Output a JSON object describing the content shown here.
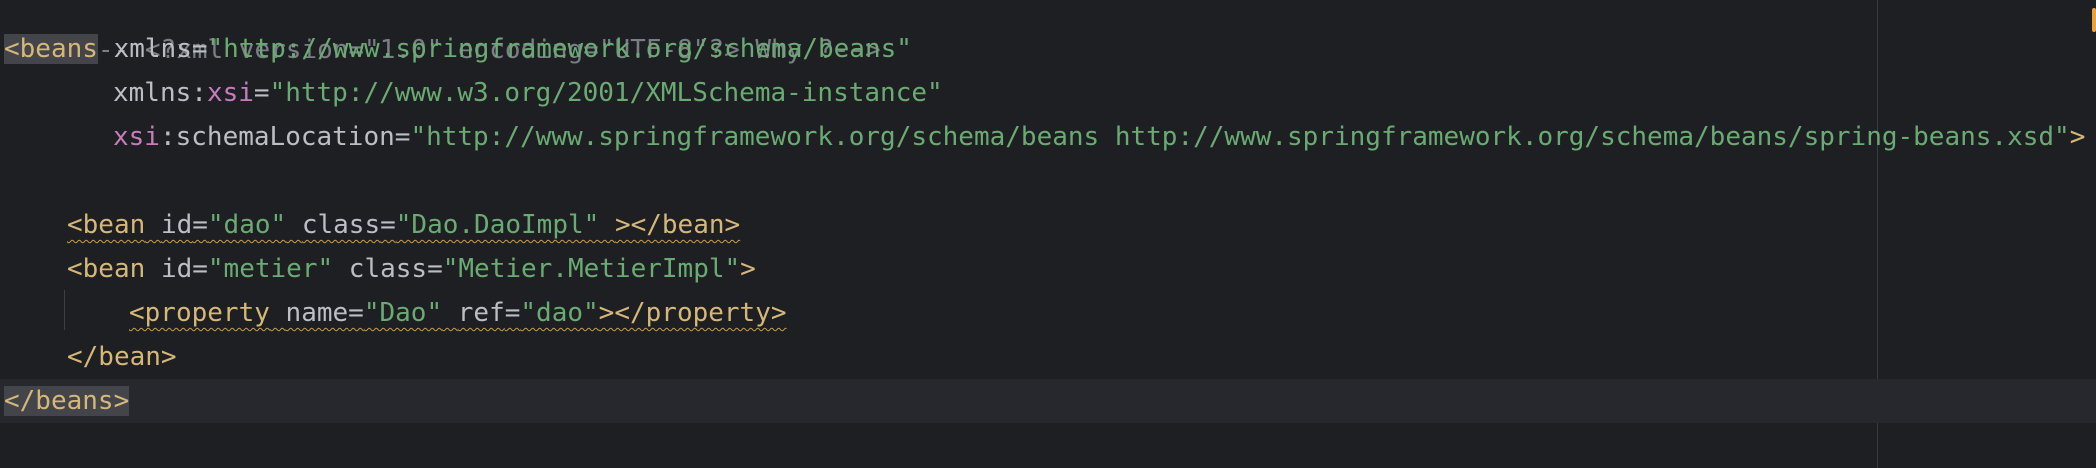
{
  "editor": {
    "lines": [
      {
        "comment": "<!-- <?xml version=\"1.0\" encoding=\"UTF-8\"?> Why ?-->"
      },
      {
        "open_tag": "<beans",
        "attr_xmlns": "xmlns",
        "eq": "=",
        "xmlns_value": "\"http://www.springframework.org/schema/beans\""
      },
      {
        "attr_xmlns": "xmlns",
        "colon": ":",
        "ns_xsi": "xsi",
        "eq": "=",
        "value": "\"http://www.w3.org/2001/XMLSchema-instance\""
      },
      {
        "ns_xsi": "xsi",
        "colon": ":",
        "attr": "schemaLocation",
        "eq": "=",
        "value": "\"http://www.springframework.org/schema/beans http://www.springframework.org/schema/beans/spring-beans.xsd\"",
        "close": ">"
      },
      {
        "open_tag": "<bean",
        "attr_id": "id",
        "eq": "=",
        "id_value": "\"dao\"",
        "attr_class": "class",
        "class_value": "\"Dao.DaoImpl\"",
        "close": "></bean>"
      },
      {
        "open_tag": "<bean",
        "attr_id": "id",
        "eq": "=",
        "id_value": "\"metier\"",
        "attr_class": "class",
        "class_value": "\"Metier.MetierImpl\"",
        "close": ">"
      },
      {
        "open_tag": "<property",
        "attr_name": "name",
        "eq": "=",
        "name_value": "\"Dao\"",
        "attr_ref": "ref",
        "ref_value": "\"dao\"",
        "close": "></property>"
      },
      {
        "close_tag": "</bean>"
      },
      {
        "close_tag": "</beans>"
      }
    ]
  },
  "colors": {
    "background": "#1e1f22",
    "tag": "#d5b778",
    "attribute": "#bcbec4",
    "namespace": "#c77dbb",
    "string": "#6aab73",
    "comment": "#7a7e85",
    "warning_underline": "#c9a04a",
    "scroll_marker": "#e8a33d"
  }
}
